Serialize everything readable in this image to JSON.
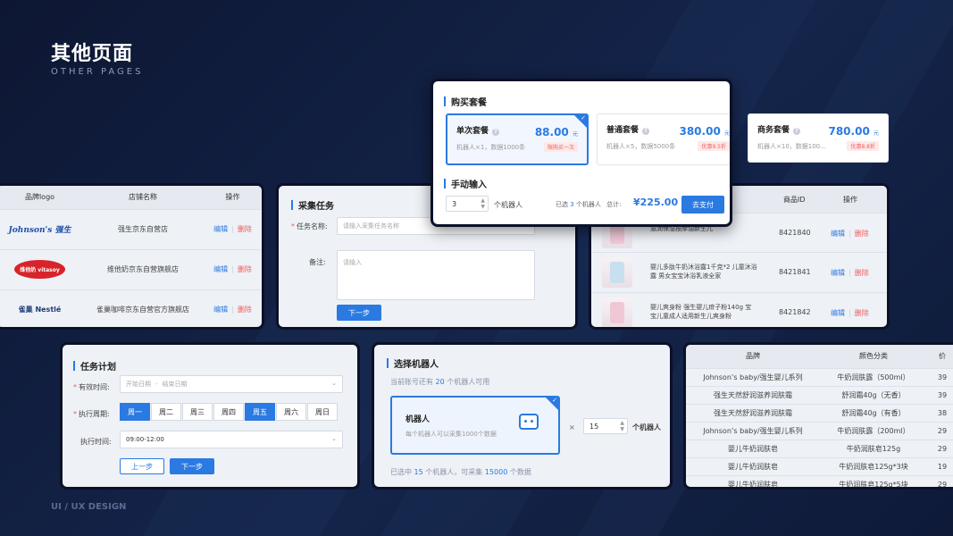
{
  "page": {
    "title": "其他页面",
    "subtitle": "OTHER PAGES",
    "footer": "UI / UX DESIGN"
  },
  "brand_table": {
    "headers": [
      "品牌logo",
      "店铺名称",
      "操作"
    ],
    "rows": [
      {
        "logo": "Johnson's 强生",
        "store": "强生京东自营店"
      },
      {
        "logo": "维他奶 vitasoy",
        "store": "维他奶京东自营旗舰店"
      },
      {
        "logo": "雀巢 Nestlé",
        "store": "雀巢咖啡京东自营官方旗舰店"
      }
    ],
    "edit": "编辑",
    "delete": "删除"
  },
  "collect_task": {
    "title": "采集任务",
    "name_label": "任务名称:",
    "name_placeholder": "请输入采集任务名称",
    "remark_label": "备注:",
    "remark_placeholder": "请输入",
    "next": "下一步"
  },
  "purchase": {
    "title": "购买套餐",
    "packages": [
      {
        "name": "单次套餐",
        "price": "88.00",
        "unit": "元",
        "desc": "机器人×1，数据1000条",
        "tag": "限购买一次",
        "selected": true
      },
      {
        "name": "普通套餐",
        "price": "380.00",
        "unit": "元",
        "desc": "机器人×5，数据5000条",
        "tag": "优惠9.5折",
        "selected": false
      },
      {
        "name": "商务套餐",
        "price": "780.00",
        "unit": "元",
        "desc": "机器人×10，数据100...",
        "tag": "优惠8.8折",
        "selected": false
      }
    ],
    "manual_title": "手动输入",
    "qty": "3",
    "qty_unit": "个机器人",
    "selected_prefix": "已选",
    "selected_count": "3",
    "selected_suffix": "个机器人",
    "total_label": "总计:",
    "total": "¥225.00",
    "pay": "去支付"
  },
  "product_table": {
    "headers": [
      "商品ID",
      "操作"
    ],
    "rows": [
      {
        "name": "滋润保湿按摩油新生儿",
        "id": "8421840"
      },
      {
        "name": "婴儿多肽牛奶沐浴露1千克*2 儿童沐浴露 男女宝宝沐浴乳液全家",
        "id": "8421841"
      },
      {
        "name": "婴儿爽身粉 强生婴儿痱子粉140g 宝宝儿童成人适用新生儿爽身粉",
        "id": "8421842"
      }
    ],
    "edit": "编辑",
    "delete": "删除"
  },
  "task_plan": {
    "title": "任务计划",
    "valid_label": "有效时间:",
    "start_placeholder": "开始日期",
    "end_placeholder": "结束日期",
    "date_sep": "-",
    "cycle_label": "执行周期:",
    "days": [
      "周一",
      "周二",
      "周三",
      "周四",
      "周五",
      "周六",
      "周日"
    ],
    "days_on": [
      true,
      false,
      false,
      false,
      true,
      false,
      false
    ],
    "time_label": "执行时间:",
    "time_value": "09:00-12:00",
    "prev": "上一步",
    "next": "下一步"
  },
  "robot_select": {
    "title": "选择机器人",
    "avail_prefix": "当前账号还有",
    "avail_count": "20",
    "avail_suffix": "个机器人可用",
    "card_title": "机器人",
    "card_desc": "每个机器人可以采集1000个数据",
    "times": "×",
    "qty": "15",
    "qty_unit": "个机器人",
    "sum_prefix": "已选中",
    "sum_count": "15",
    "sum_mid": "个机器人，可采集",
    "sum_data": "15000",
    "sum_suffix": "个数据"
  },
  "brand_sku": {
    "headers": [
      "品牌",
      "颜色分类",
      "价"
    ],
    "rows": [
      {
        "brand": "Johnson’s baby/强生婴儿系列",
        "color": "牛奶润肤露（500ml）",
        "price": "39"
      },
      {
        "brand": "强生天然舒润滋养润肤霜",
        "color": "舒润霜40g（无香）",
        "price": "39"
      },
      {
        "brand": "强生天然舒润滋养润肤霜",
        "color": "舒润霜40g（有香）",
        "price": "38"
      },
      {
        "brand": "Johnson’s baby/强生婴儿系列",
        "color": "牛奶润肤露（200ml）",
        "price": "29"
      },
      {
        "brand": "婴儿牛奶润肤皂",
        "color": "牛奶润肤皂125g",
        "price": "29"
      },
      {
        "brand": "婴儿牛奶润肤皂",
        "color": "牛奶润肤皂125g*3块",
        "price": "19"
      },
      {
        "brand": "婴儿牛奶润肤皂",
        "color": "牛奶润肤皂125g*5块",
        "price": "29"
      }
    ]
  }
}
